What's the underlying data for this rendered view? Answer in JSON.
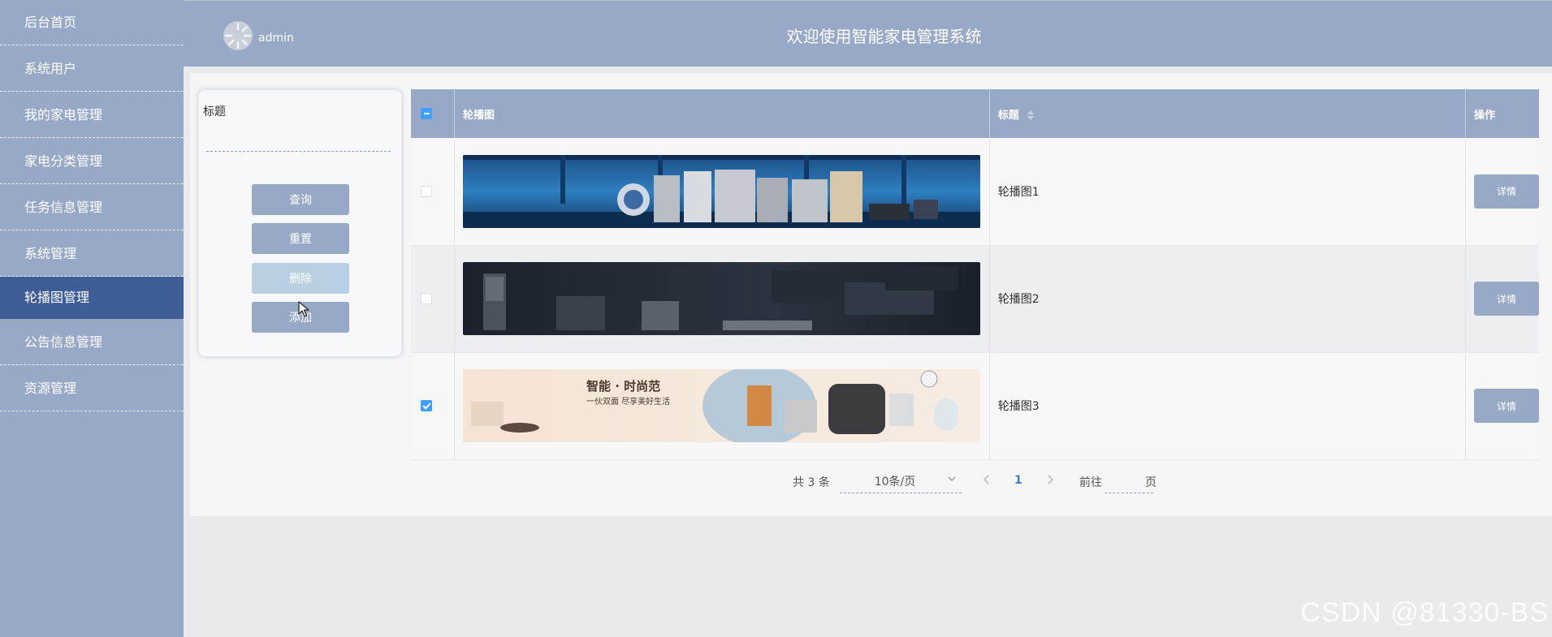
{
  "header": {
    "title": "欢迎使用智能家电管理系统",
    "user_name": "admin"
  },
  "sidebar": {
    "items": [
      {
        "label": "后台首页",
        "active": false
      },
      {
        "label": "系统用户",
        "active": false
      },
      {
        "label": "我的家电管理",
        "active": false
      },
      {
        "label": "家电分类管理",
        "active": false
      },
      {
        "label": "任务信息管理",
        "active": false
      },
      {
        "label": "系统管理",
        "active": false
      },
      {
        "label": "轮播图管理",
        "active": true
      },
      {
        "label": "公告信息管理",
        "active": false
      },
      {
        "label": "资源管理",
        "active": false
      }
    ]
  },
  "search": {
    "label": "标题",
    "value": "",
    "buttons": {
      "query": "查询",
      "reset": "重置",
      "delete": "删除",
      "add": "添加"
    }
  },
  "table": {
    "columns": [
      "轮播图",
      "标题",
      "操作"
    ],
    "header_checkbox": "indeterminate",
    "rows": [
      {
        "title": "轮播图1",
        "checked": false,
        "action": "详情",
        "image": "appliances-showroom-blue"
      },
      {
        "title": "轮播图2",
        "checked": false,
        "action": "详情",
        "image": "appliances-dark"
      },
      {
        "title": "轮播图3",
        "checked": true,
        "action": "详情",
        "image": "smart-kitchen-promo",
        "image_text": [
          "智能 · 时尚范",
          "一伙双面 尽享美好生活"
        ]
      }
    ]
  },
  "pagination": {
    "total": "共 3 条",
    "page_size": "10条/页",
    "current_page": "1",
    "goto_label": "前往",
    "goto_value": "",
    "page_suffix": "页"
  },
  "watermark": "CSDN @81330-BS",
  "colors": {
    "sidebar_bg": "#97a9c6",
    "sidebar_active": "#3e5d97",
    "accent": "#409eff"
  }
}
